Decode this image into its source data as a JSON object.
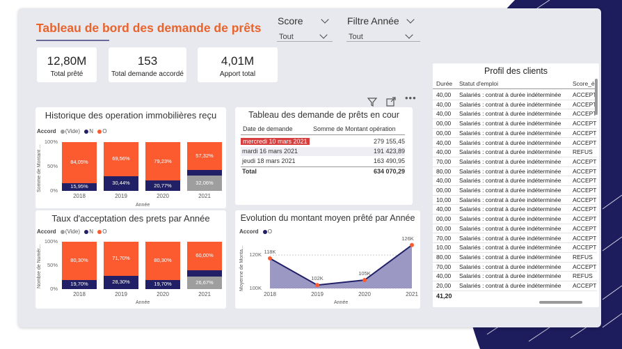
{
  "dashboard": {
    "title": "Tableau de bord des demande de prêts",
    "filters": [
      {
        "label": "Score",
        "value": "Tout"
      },
      {
        "label": "Filtre Année",
        "value": "Tout"
      }
    ],
    "kpis": [
      {
        "value": "12,80M",
        "label": "Total prêté"
      },
      {
        "value": "153",
        "label": "Total demande accordé"
      },
      {
        "value": "4,01M",
        "label": "Apport total"
      }
    ],
    "icons": [
      "filter-icon",
      "focus-mode-icon",
      "more-options-icon"
    ]
  },
  "colors": {
    "accent": "#e8642d",
    "series_o": "#fc5b2f",
    "series_n": "#212067",
    "series_vide": "#9e9e9e",
    "area": "#9b98c4"
  },
  "table": {
    "title": "Tableau des demande de prêts en cour",
    "col_date": "Date de demande",
    "col_amount": "Somme de Montant opération",
    "rows": [
      {
        "date": "mercredi 10 mars 2021",
        "amount": "279 155,45"
      },
      {
        "date": "mardi 16 mars 2021",
        "amount": "191 423,89"
      },
      {
        "date": "jeudi 18 mars 2021",
        "amount": "163 490,95"
      }
    ],
    "total_label": "Total",
    "total_value": "634 070,29"
  },
  "profile": {
    "title": "Profil des clients",
    "columns": [
      "Durée",
      "Statut d'emploi",
      "Score_é"
    ],
    "rows": [
      {
        "duree": "40,00",
        "statut": "Salariés : contrat à durée indéterminée",
        "score": "ACCEPT"
      },
      {
        "duree": "40,00",
        "statut": "Salariés : contrat à durée indéterminée",
        "score": "ACCEPT"
      },
      {
        "duree": "40,00",
        "statut": "Salariés : contrat à durée indéterminée",
        "score": "ACCEPT"
      },
      {
        "duree": "00,00",
        "statut": "Salariés : contrat à durée indéterminée",
        "score": "ACCEPT"
      },
      {
        "duree": "00,00",
        "statut": "Salariés : contrat à durée indéterminée",
        "score": "ACCEPT"
      },
      {
        "duree": "40,00",
        "statut": "Salariés : contrat à durée indéterminée",
        "score": "ACCEPT"
      },
      {
        "duree": "40,00",
        "statut": "Salariés : contrat à durée indéterminée",
        "score": "REFUS"
      },
      {
        "duree": "70,00",
        "statut": "Salariés : contrat à durée indéterminée",
        "score": "ACCEPT"
      },
      {
        "duree": "80,00",
        "statut": "Salariés : contrat à durée indéterminée",
        "score": "ACCEPT"
      },
      {
        "duree": "40,00",
        "statut": "Salariés : contrat à durée indéterminée",
        "score": "ACCEPT"
      },
      {
        "duree": "00,00",
        "statut": "Salariés : contrat à durée indéterminée",
        "score": "ACCEPT"
      },
      {
        "duree": "10,00",
        "statut": "Salariés : contrat à durée indéterminée",
        "score": "ACCEPT"
      },
      {
        "duree": "40,00",
        "statut": "Salariés : contrat à durée indéterminée",
        "score": "ACCEPT"
      },
      {
        "duree": "00,00",
        "statut": "Salariés : contrat à durée indéterminée",
        "score": "ACCEPT"
      },
      {
        "duree": "00,00",
        "statut": "Salariés : contrat à durée indéterminée",
        "score": "ACCEPT"
      },
      {
        "duree": "70,00",
        "statut": "Salariés : contrat à durée indéterminée",
        "score": "ACCEPT"
      },
      {
        "duree": "10,00",
        "statut": "Salariés : contrat à durée indéterminée",
        "score": "ACCEPT"
      },
      {
        "duree": "80,00",
        "statut": "Salariés : contrat à durée indéterminée",
        "score": "REFUS"
      },
      {
        "duree": "70,00",
        "statut": "Salariés : contrat à durée indéterminée",
        "score": "ACCEPT"
      },
      {
        "duree": "40,00",
        "statut": "Salariés : contrat à durée indéterminée",
        "score": "REFUS"
      },
      {
        "duree": "20,00",
        "statut": "Salariés : contrat à durée indéterminée",
        "score": "ACCEPT"
      }
    ],
    "total": "41,20"
  },
  "chart_data": [
    {
      "id": "historique",
      "type": "bar",
      "stacked": true,
      "title": "Historique des operation immobilières reçu",
      "legend_title": "Accord",
      "legend": [
        "(Vide)",
        "N",
        "O"
      ],
      "ylabel": "Somme de Montant ...",
      "xlabel": "Année",
      "yticks": [
        "100%",
        "50%",
        "0%"
      ],
      "categories": [
        "2018",
        "2019",
        "2020",
        "2021"
      ],
      "series": [
        {
          "name": "(Vide)",
          "values": [
            0,
            0,
            0,
            32.06
          ],
          "labels": [
            "",
            "",
            "",
            "32,06%"
          ]
        },
        {
          "name": "N",
          "values": [
            15.95,
            30.44,
            20.77,
            10.62
          ],
          "labels": [
            "15,95%",
            "30,44%",
            "20,77%",
            ""
          ]
        },
        {
          "name": "O",
          "values": [
            84.05,
            69.56,
            79.23,
            57.32
          ],
          "labels": [
            "84,05%",
            "69,56%",
            "79,23%",
            "57,32%"
          ]
        }
      ]
    },
    {
      "id": "taux",
      "type": "bar",
      "stacked": true,
      "title": "Taux d'acceptation des prets par Année",
      "legend_title": "Accord",
      "legend": [
        "(Vide)",
        "N",
        "O"
      ],
      "ylabel": "Nombre de Numér...",
      "xlabel": "Année",
      "yticks": [
        "100%",
        "50%",
        "0%"
      ],
      "categories": [
        "2018",
        "2019",
        "2020",
        "2021"
      ],
      "series": [
        {
          "name": "(Vide)",
          "values": [
            0,
            0,
            0,
            26.67
          ],
          "labels": [
            "",
            "",
            "",
            "26,67%"
          ]
        },
        {
          "name": "N",
          "values": [
            19.7,
            28.3,
            19.7,
            13.33
          ],
          "labels": [
            "19,70%",
            "28,30%",
            "19,70%",
            ""
          ]
        },
        {
          "name": "O",
          "values": [
            80.3,
            71.7,
            80.3,
            60.0
          ],
          "labels": [
            "80,30%",
            "71,70%",
            "80,30%",
            "60,00%"
          ]
        }
      ]
    },
    {
      "id": "evolution",
      "type": "area",
      "title": "Evolution du montant moyen prêté par Année",
      "legend_title": "Accord",
      "legend": [
        "O"
      ],
      "ylabel": "Moyenne de Monta...",
      "xlabel": "Année",
      "yticks": [
        "120K",
        "100K"
      ],
      "ylim": [
        100,
        128
      ],
      "categories": [
        "2018",
        "2019",
        "2020",
        "2021"
      ],
      "values": [
        118,
        102,
        105,
        126
      ],
      "labels": [
        "118K",
        "102K",
        "105K",
        "126K"
      ]
    }
  ]
}
